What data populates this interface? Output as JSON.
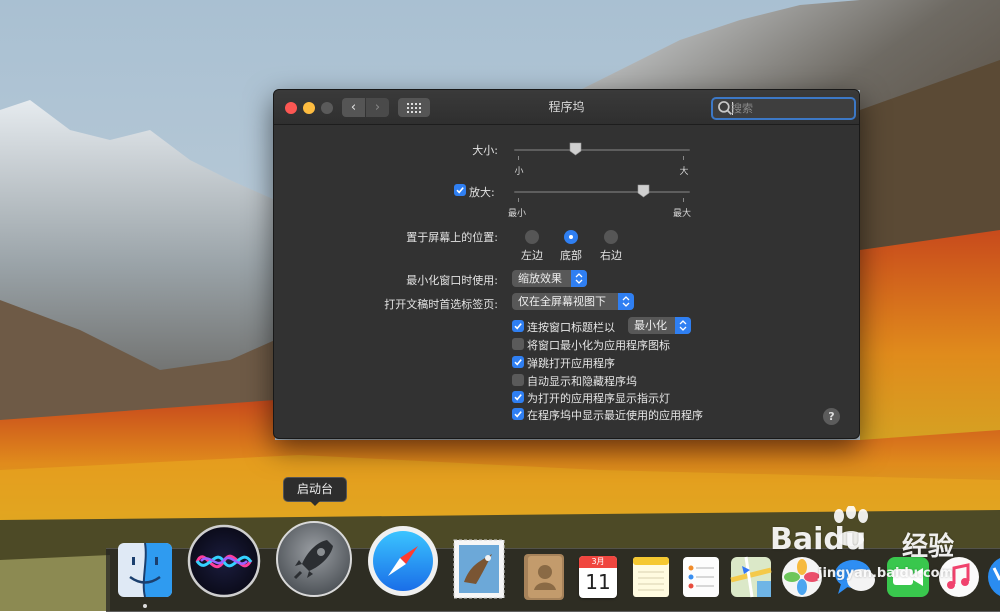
{
  "window": {
    "title": "程序坞",
    "search": {
      "placeholder": "搜索"
    }
  },
  "size": {
    "label": "大小:",
    "min_label": "小",
    "max_label": "大",
    "value": 0.35
  },
  "magnification": {
    "checked": true,
    "label": "放大:",
    "min_label": "最小",
    "max_label": "最大",
    "value": 0.78
  },
  "position": {
    "label": "置于屏幕上的位置:",
    "options": [
      {
        "label": "左边",
        "selected": false
      },
      {
        "label": "底部",
        "selected": true
      },
      {
        "label": "右边",
        "selected": false
      }
    ]
  },
  "minimize_effect": {
    "label": "最小化窗口时使用:",
    "value": "缩放效果"
  },
  "prefer_tabs": {
    "label": "打开文稿时首选标签页:",
    "value": "仅在全屏幕视图下"
  },
  "checkboxes": [
    {
      "label": "连按窗口标题栏以",
      "checked": true,
      "popup_value": "最小化"
    },
    {
      "label": "将窗口最小化为应用程序图标",
      "checked": false
    },
    {
      "label": "弹跳打开应用程序",
      "checked": true
    },
    {
      "label": "自动显示和隐藏程序坞",
      "checked": false
    },
    {
      "label": "为打开的应用程序显示指示灯",
      "checked": true
    },
    {
      "label": "在程序坞中显示最近使用的应用程序",
      "checked": true
    }
  ],
  "help": {
    "label": "?"
  },
  "tooltip": {
    "text": "启动台"
  },
  "calendar_icon": {
    "month": "3月",
    "day": "11"
  },
  "dock_items": [
    "finder-icon",
    "siri-icon",
    "launchpad-icon",
    "safari-icon",
    "mail-icon",
    "contacts-icon",
    "calendar-icon",
    "notes-icon",
    "reminders-icon",
    "maps-icon",
    "photos-icon",
    "messages-icon",
    "facetime-icon",
    "music-icon",
    "app-store-icon"
  ],
  "watermark": {
    "brand": "Baidu",
    "cn": "经验",
    "url": "jingyan.baidu.com"
  },
  "colors": {
    "accent": "#2f7ff2",
    "window_bg": "#323232",
    "close": "#fc5753",
    "minimize": "#fdbc40"
  }
}
